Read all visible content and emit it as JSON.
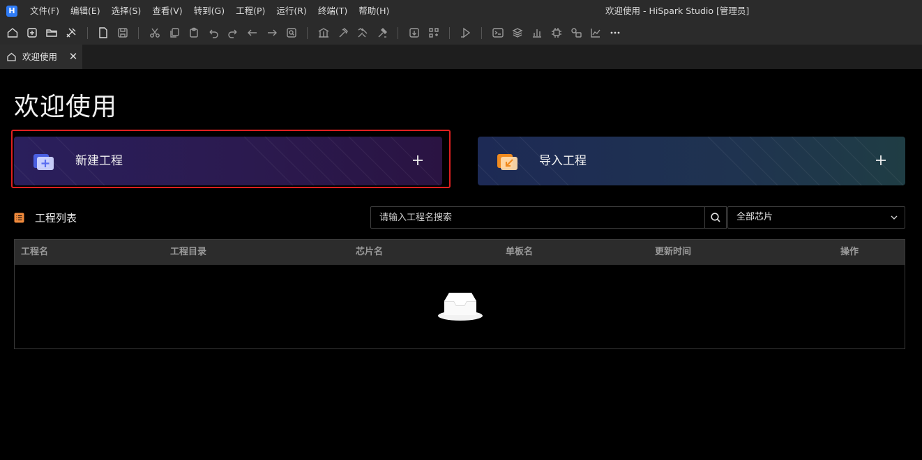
{
  "app": {
    "logo_letter": "H",
    "window_title": "欢迎使用 - HiSpark Studio [管理员]"
  },
  "menu": [
    "文件(F)",
    "编辑(E)",
    "选择(S)",
    "查看(V)",
    "转到(G)",
    "工程(P)",
    "运行(R)",
    "终端(T)",
    "帮助(H)"
  ],
  "toolbar": {
    "icons": [
      "home-icon",
      "new-file-plus-icon",
      "open-folder-icon",
      "tools-icon",
      "new-doc-icon",
      "save-icon",
      "cut-icon",
      "copy-icon",
      "paste-icon",
      "undo-icon",
      "redo-icon",
      "back-icon",
      "forward-icon",
      "find-icon",
      "build-icon",
      "hammer-icon",
      "rebuild-icon",
      "clean-icon",
      "burn-icon",
      "debug-icon",
      "run-icon",
      "terminal-icon",
      "layers-icon",
      "chart-bar-icon",
      "chip-icon",
      "peripheral-icon",
      "trend-icon",
      "more-icon"
    ]
  },
  "tab": {
    "label": "欢迎使用",
    "close": "✕"
  },
  "page": {
    "title": "欢迎使用"
  },
  "cards": {
    "new_project": "新建工程",
    "import_project": "导入工程"
  },
  "project_list": {
    "title": "工程列表",
    "search_placeholder": "请输入工程名搜索",
    "chip_filter": "全部芯片",
    "columns": [
      "工程名",
      "工程目录",
      "芯片名",
      "单板名",
      "更新时间",
      "操作"
    ],
    "rows": []
  },
  "colors": {
    "highlight": "#e02020",
    "list_icon": "#f08a3c"
  }
}
